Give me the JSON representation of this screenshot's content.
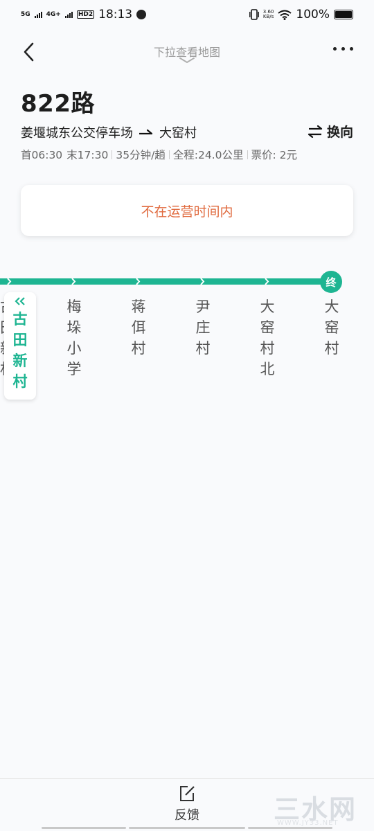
{
  "status_bar": {
    "signal1": "5G",
    "signal2": "4G+",
    "hd_label": "HD2",
    "time": "18:13",
    "net_speed_value": "3.60",
    "net_speed_unit": "KB/s",
    "battery_percent": "100%"
  },
  "nav": {
    "pull_hint": "下拉查看地图"
  },
  "route": {
    "title": "822路",
    "from": "姜堰城东公交停车场",
    "to": "大窑村",
    "swap_label": "换向",
    "first_bus": "首06:30",
    "last_bus": "末17:30",
    "interval": "35分钟/趟",
    "distance": "全程:24.0公里",
    "fare": "票价: 2元"
  },
  "status_card": {
    "message": "不在运营时间内"
  },
  "line": {
    "color": "#1eb592",
    "end_badge": "终",
    "current_stop": "古田新村",
    "stops": [
      "梅垛小学",
      "蒋佴村",
      "尹庄村",
      "大窑村北",
      "大窑村"
    ]
  },
  "bottom": {
    "feedback_label": "反馈",
    "watermark": "三水网",
    "watermark_sub": "WWW.JY33.NET"
  }
}
